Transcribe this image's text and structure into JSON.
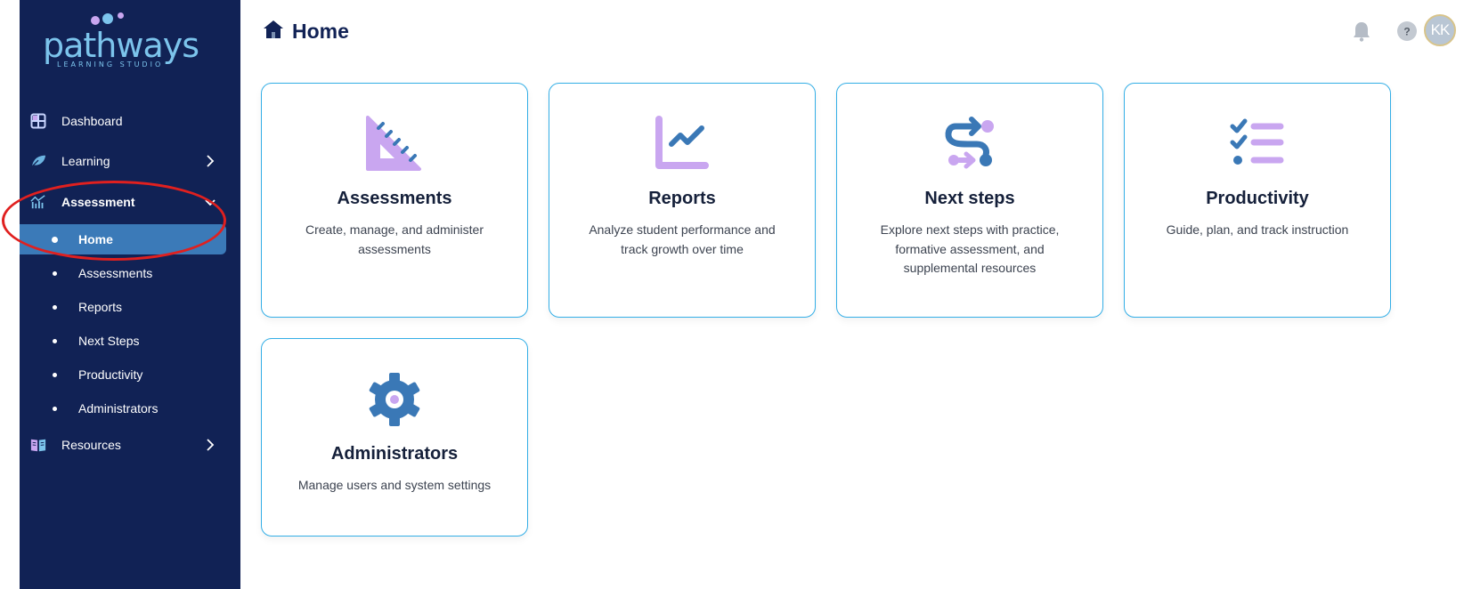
{
  "brand": {
    "name": "pathways",
    "tagline": "LEARNING STUDIO"
  },
  "sidebar": {
    "items": [
      {
        "label": "Dashboard"
      },
      {
        "label": "Learning"
      },
      {
        "label": "Assessment"
      },
      {
        "label": "Resources"
      }
    ],
    "assessment_subitems": [
      {
        "label": "Home"
      },
      {
        "label": "Assessments"
      },
      {
        "label": "Reports"
      },
      {
        "label": "Next Steps"
      },
      {
        "label": "Productivity"
      },
      {
        "label": "Administrators"
      }
    ],
    "active_subitem": "Home"
  },
  "header": {
    "title": "Home",
    "user_initials": "KK"
  },
  "cards": [
    {
      "title": "Assessments",
      "description": "Create, manage, and administer assessments",
      "icon": "ruler-triangle-icon"
    },
    {
      "title": "Reports",
      "description": "Analyze student performance and track growth over time",
      "icon": "line-chart-icon"
    },
    {
      "title": "Next steps",
      "description": "Explore next steps with practice, formative assessment, and supplemental resources",
      "icon": "route-icon"
    },
    {
      "title": "Productivity",
      "description": "Guide, plan, and track instruction",
      "icon": "checklist-icon"
    },
    {
      "title": "Administrators",
      "description": "Manage users and system settings",
      "icon": "gear-icon"
    }
  ],
  "colors": {
    "sidebar_bg": "#112255",
    "active_bg": "#3b7ab8",
    "accent_lavender": "#c9a6f0",
    "accent_blue": "#3a78b6",
    "card_border": "#33aee6",
    "annotation": "#e0201f"
  }
}
